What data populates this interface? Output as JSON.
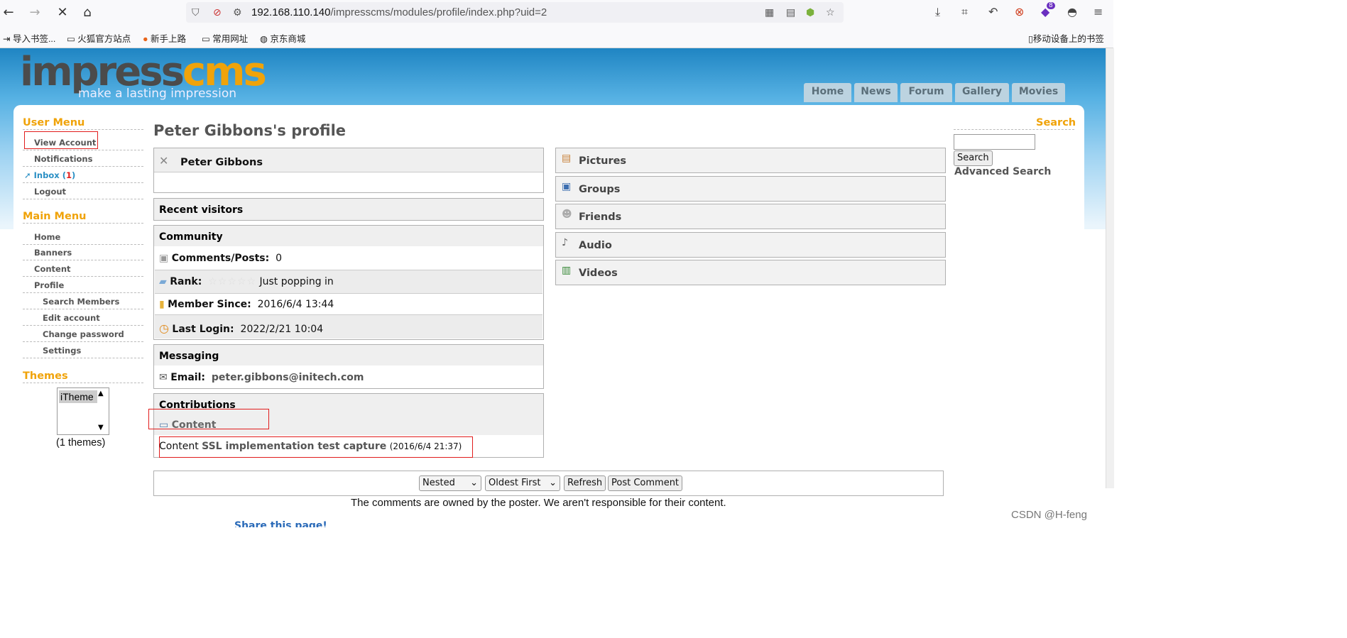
{
  "browser": {
    "url_host": "192.168.110.140",
    "url_path": "/impresscms/modules/profile/index.php?uid=2",
    "extension_badge": "8",
    "bookmarks": [
      "导入书签...",
      "火狐官方站点",
      "新手上路",
      "常用网址",
      "京东商城"
    ],
    "mobile_bookmarks": "移动设备上的书签"
  },
  "site": {
    "logo_main": "impress",
    "logo_accent": "cms",
    "tagline": "make a lasting impression",
    "nav": [
      "Home",
      "News",
      "Forum",
      "Gallery",
      "Movies"
    ]
  },
  "user_menu": {
    "title": "User Menu",
    "items": [
      "View Account",
      "Notifications",
      "Inbox",
      "Logout"
    ],
    "inbox_count": "1"
  },
  "main_menu": {
    "title": "Main Menu",
    "items": [
      "Home",
      "Banners",
      "Content",
      "Profile"
    ],
    "subitems": [
      "Search Members",
      "Edit account",
      "Change password",
      "Settings"
    ]
  },
  "themes": {
    "title": "Themes",
    "selected": "iTheme",
    "count_text": "(1 themes)"
  },
  "profile": {
    "title": "Peter Gibbons's profile",
    "name": "Peter Gibbons",
    "recent_visitors": "Recent visitors",
    "community": "Community",
    "comments_label": "Comments/Posts:",
    "comments_value": "0",
    "rank_label": "Rank:",
    "rank_stars": 0,
    "rank_value": "Just popping in",
    "member_since_label": "Member Since:",
    "member_since_value": "2016/6/4 13:44",
    "last_login_label": "Last Login:",
    "last_login_value": "2022/2/21 10:04",
    "messaging": "Messaging",
    "email_label": "Email:",
    "email_value": "peter.gibbons@initech.com",
    "contributions": "Contributions",
    "content_heading": "Content",
    "content_prefix": "Content",
    "content_link": "SSL implementation test capture",
    "content_date": "(2016/6/4 21:37)"
  },
  "right_panels": [
    "Pictures",
    "Groups",
    "Friends",
    "Audio",
    "Videos"
  ],
  "search": {
    "title": "Search",
    "button": "Search",
    "advanced": "Advanced Search"
  },
  "comments_bar": {
    "mode": "Nested",
    "order": "Oldest First",
    "refresh": "Refresh",
    "post": "Post Comment",
    "disclaimer": "The comments are owned by the poster. We aren't responsible for their content.",
    "share": "Share this page!"
  },
  "watermark": "CSDN @H-feng",
  "colors": {
    "accent": "#f0a30a",
    "link": "#2a8fc4",
    "highlight": "#e11d1d"
  }
}
